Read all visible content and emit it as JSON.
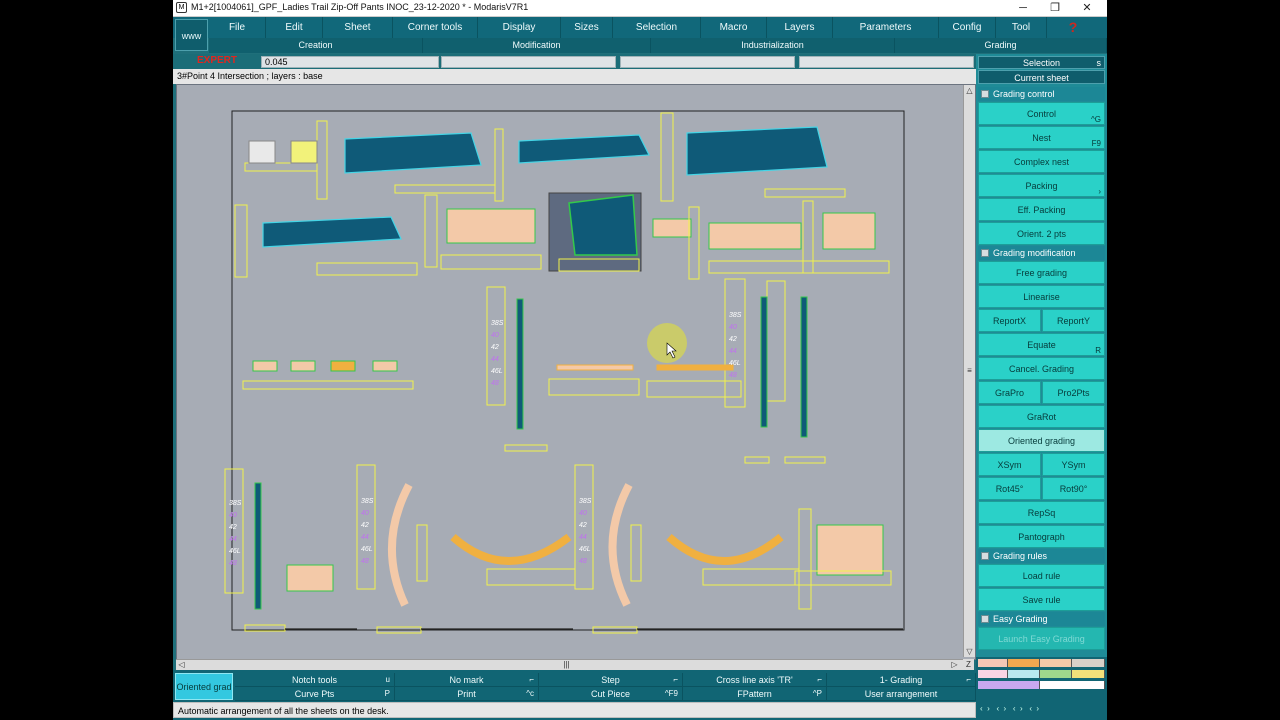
{
  "window": {
    "title": "M1+2[1004061]_GPF_Ladies Trail Zip-Off Pants INOC_23-12-2020 *  - ModarisV7R1",
    "minimize_glyph": "─",
    "maximize_glyph": "❐",
    "close_glyph": "✕",
    "logo_glyph": "M"
  },
  "menubar": {
    "www_label": "www",
    "items": [
      "File",
      "Edit",
      "Sheet",
      "Corner tools",
      "Display",
      "Sizes",
      "Selection",
      "Macro",
      "Layers",
      "Parameters",
      "Config",
      "Tool"
    ],
    "help_glyph": "?"
  },
  "groups": [
    "Creation",
    "Modification",
    "Industrialization",
    "Grading"
  ],
  "toolbar": {
    "mode_label": "EXPERT",
    "value": "0.045"
  },
  "status_line": "3#Point 4 Intersection ;    layers :  base",
  "right_panel": {
    "selection_label": "Selection",
    "selection_shortcut": "s",
    "current_sheet_label": "Current sheet",
    "sections": [
      {
        "title": "Grading control",
        "rows": [
          [
            {
              "label": "Control",
              "shortcut": "^G"
            }
          ],
          [
            {
              "label": "Nest",
              "shortcut": "F9"
            }
          ],
          [
            {
              "label": "Complex nest",
              "shortcut": ""
            }
          ],
          [
            {
              "label": "Packing",
              "shortcut": "›"
            }
          ],
          [
            {
              "label": "Eff. Packing",
              "shortcut": ""
            }
          ],
          [
            {
              "label": "Orient. 2 pts",
              "shortcut": ""
            }
          ]
        ]
      },
      {
        "title": "Grading modification",
        "rows": [
          [
            {
              "label": "Free grading",
              "shortcut": ""
            }
          ],
          [
            {
              "label": "Linearise",
              "shortcut": ""
            }
          ],
          [
            {
              "label": "ReportX",
              "shortcut": ""
            },
            {
              "label": "ReportY",
              "shortcut": ""
            }
          ],
          [
            {
              "label": "Equate",
              "shortcut": "R"
            }
          ],
          [
            {
              "label": "Cancel. Grading",
              "shortcut": ""
            }
          ],
          [
            {
              "label": "GraPro",
              "shortcut": ""
            },
            {
              "label": "Pro2Pts",
              "shortcut": ""
            }
          ],
          [
            {
              "label": "GraRot",
              "shortcut": ""
            }
          ],
          [
            {
              "label": "Oriented grading",
              "shortcut": "",
              "active": true
            }
          ],
          [
            {
              "label": "XSym",
              "shortcut": ""
            },
            {
              "label": "YSym",
              "shortcut": ""
            }
          ],
          [
            {
              "label": "Rot45°",
              "shortcut": ""
            },
            {
              "label": "Rot90°",
              "shortcut": ""
            }
          ],
          [
            {
              "label": "RepSq",
              "shortcut": ""
            }
          ],
          [
            {
              "label": "Pantograph",
              "shortcut": ""
            }
          ]
        ]
      },
      {
        "title": "Grading rules",
        "rows": [
          [
            {
              "label": "Load rule",
              "shortcut": ""
            }
          ],
          [
            {
              "label": "Save rule",
              "shortcut": ""
            }
          ]
        ]
      },
      {
        "title": "Easy Grading",
        "rows": [
          [
            {
              "label": "Launch Easy Grading",
              "shortcut": "",
              "disabled": true
            }
          ]
        ]
      }
    ]
  },
  "bottom_bar": {
    "active_tool": "Oriented grad",
    "row1": [
      {
        "label": "Notch tools",
        "shortcut": "u"
      },
      {
        "label": "No mark",
        "shortcut": "⌐"
      },
      {
        "label": "Step",
        "shortcut": "⌐"
      },
      {
        "label": "Cross line axis 'TR'",
        "shortcut": "⌐"
      },
      {
        "label": "1- Grading",
        "shortcut": "⌐"
      }
    ],
    "row2": [
      {
        "label": "Curve Pts",
        "shortcut": "P"
      },
      {
        "label": "Print",
        "shortcut": "^c"
      },
      {
        "label": "Cut Piece",
        "shortcut": "^F9"
      },
      {
        "label": "FPattern",
        "shortcut": "^P"
      },
      {
        "label": "User arrangement",
        "shortcut": ""
      }
    ]
  },
  "help_line": "Automatic arrangement of all the sheets on the desk.",
  "scroll": {
    "left_arrow": "◁",
    "right_arrow": "▷",
    "up_arrow": "△",
    "down_arrow": "▽",
    "z_label": "Z"
  },
  "canvas_labels": {
    "size_codes": [
      "38S",
      "40",
      "42",
      "44",
      "46L",
      "48"
    ]
  },
  "colors": {
    "desk_bg": "#a7acb5",
    "piece_dark": "#0f5a78",
    "piece_peach": "#f3c9a8",
    "piece_orange": "#f0b040",
    "outline_yellow": "#f2f24a",
    "accent_green": "#34c94a",
    "accent_cyan": "#45d5e6"
  }
}
